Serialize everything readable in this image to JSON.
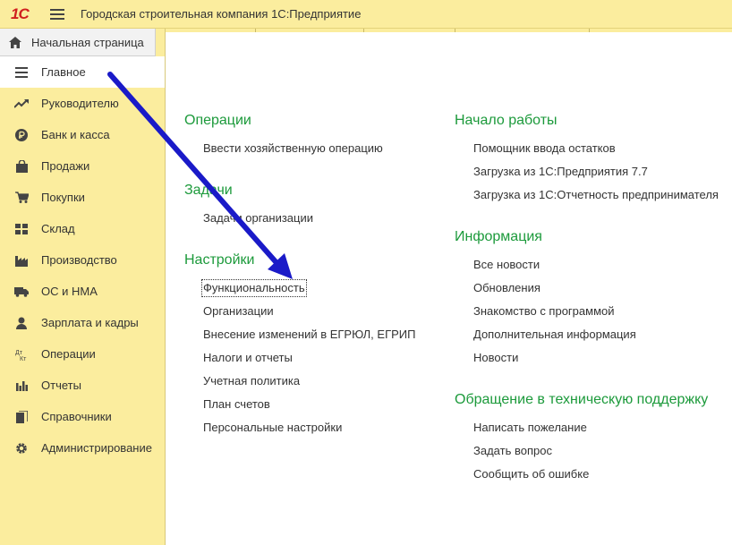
{
  "header": {
    "logo": "1С",
    "title": "Городская строительная компания 1С:Предприятие"
  },
  "sidebar": {
    "home": "Начальная страница",
    "items": [
      {
        "label": "Главное",
        "icon": "menu-lines-icon"
      },
      {
        "label": "Руководителю",
        "icon": "trend-icon"
      },
      {
        "label": "Банк и касса",
        "icon": "ruble-coin-icon"
      },
      {
        "label": "Продажи",
        "icon": "shopping-bag-icon"
      },
      {
        "label": "Покупки",
        "icon": "cart-icon"
      },
      {
        "label": "Склад",
        "icon": "warehouse-icon"
      },
      {
        "label": "Производство",
        "icon": "factory-icon"
      },
      {
        "label": "ОС и НМА",
        "icon": "truck-icon"
      },
      {
        "label": "Зарплата и кадры",
        "icon": "person-icon"
      },
      {
        "label": "Операции",
        "icon": "debit-credit-icon"
      },
      {
        "label": "Отчеты",
        "icon": "bar-chart-icon"
      },
      {
        "label": "Справочники",
        "icon": "books-icon"
      },
      {
        "label": "Администрирование",
        "icon": "gear-icon"
      }
    ]
  },
  "left_column": {
    "operations": {
      "title": "Операции",
      "links": [
        "Ввести хозяйственную операцию"
      ]
    },
    "tasks": {
      "title": "Задачи",
      "links": [
        "Задачи организации"
      ]
    },
    "settings": {
      "title": "Настройки",
      "links": [
        "Функциональность",
        "Организации",
        "Внесение изменений в ЕГРЮЛ, ЕГРИП",
        "Налоги и отчеты",
        "Учетная политика",
        "План счетов",
        "Персональные настройки"
      ]
    }
  },
  "right_column": {
    "start": {
      "title": "Начало работы",
      "links": [
        "Помощник ввода остатков",
        "Загрузка из 1С:Предприятия 7.7",
        "Загрузка из 1С:Отчетность предпринимателя"
      ]
    },
    "info": {
      "title": "Информация",
      "links": [
        "Все новости",
        "Обновления",
        "Знакомство с программой",
        "Дополнительная информация",
        "Новости"
      ]
    },
    "support": {
      "title": "Обращение в техническую поддержку",
      "links": [
        "Написать пожелание",
        "Задать вопрос",
        "Сообщить об ошибке"
      ]
    }
  },
  "colors": {
    "accent_green": "#1c9a3b",
    "panel_yellow": "#fbed9e",
    "arrow_blue": "#1a1ac8"
  }
}
